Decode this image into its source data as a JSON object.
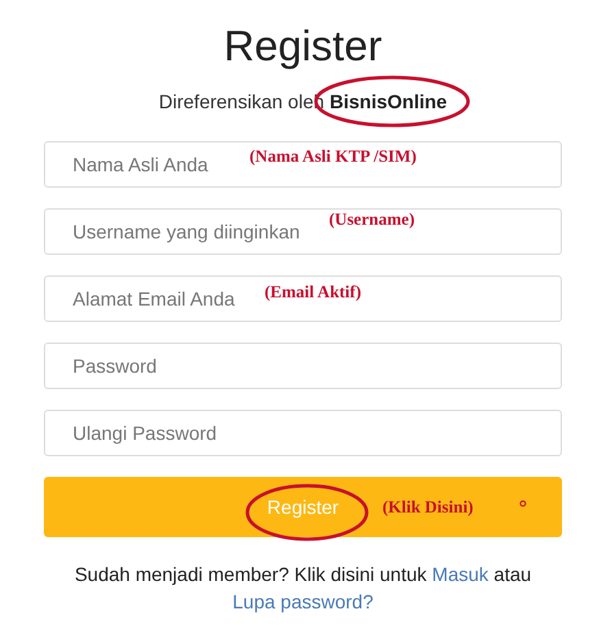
{
  "title": "Register",
  "referral": {
    "label": "Direferensikan oleh",
    "name": "BisnisOnline",
    "circled": true
  },
  "fields": [
    {
      "placeholder": "Nama Asli Anda",
      "annotation": "(Nama Asli KTP /SIM)"
    },
    {
      "placeholder": "Username yang diinginkan",
      "annotation": "(Username)"
    },
    {
      "placeholder": "Alamat Email Anda",
      "annotation": "(Email Aktif)"
    },
    {
      "placeholder": "Password"
    },
    {
      "placeholder": "Ulangi Password"
    }
  ],
  "submit": {
    "label": "Register",
    "annotation": "(Klik Disini)",
    "circled": true
  },
  "footer": [
    {
      "kind": "text",
      "text": "Sudah menjadi member? Klik disini untuk"
    },
    {
      "kind": "link",
      "text": "Masuk"
    },
    {
      "kind": "text",
      "text": "atau"
    },
    {
      "kind": "link",
      "text": "Lupa password?"
    }
  ]
}
